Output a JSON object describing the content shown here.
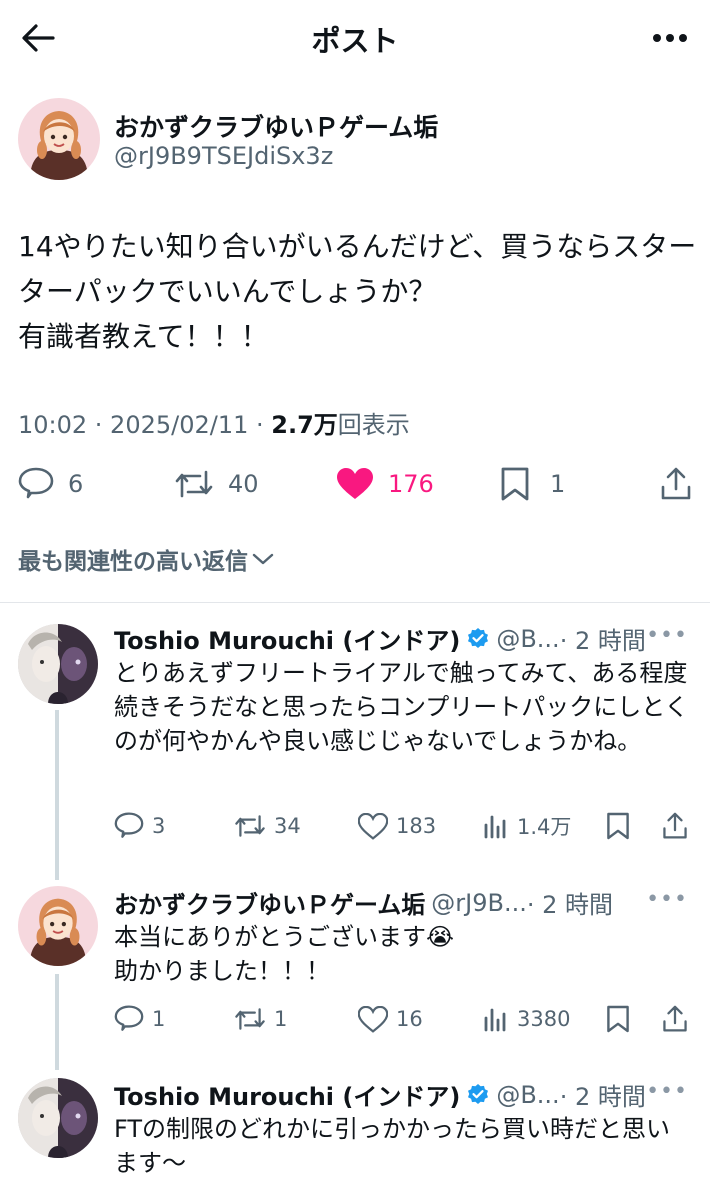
{
  "header": {
    "title": "ポスト"
  },
  "post": {
    "author": "おかずクラブゆいＰゲーム垢",
    "handle": "@rJ9B9TSEJdiSx3z",
    "text": "14やりたい知り合いがいるんだけど、買うならスターターパックでいいんでしょうか？\n有識者教えて！！！",
    "time": "10:02 · 2025/02/11 · ",
    "views": "2.7万",
    "views_label": "回表示",
    "replies": "6",
    "reposts": "40",
    "likes": "176",
    "bookmarks": "1",
    "like_color": "#f91880"
  },
  "sort_label": "最も関連性の高い返信",
  "replies": [
    {
      "author": "Toshio Murouchi (インドア)",
      "handle": "@B...",
      "time": "· 2 時間",
      "text": "とりあえずフリートライアルで触ってみて、ある程度続きそうだなと思ったらコンプリートパックにしとくのが何やかんや良い感じじゃないでしょうかね。",
      "replies": "3",
      "reposts": "34",
      "likes": "183",
      "views": "1.4万",
      "verified": true
    },
    {
      "author": "おかずクラブゆいＰゲーム垢",
      "handle": "@rJ9B...",
      "time": "· 2 時間",
      "text": "本当にありがとうございます😭\n助かりました！！！",
      "replies": "1",
      "reposts": "1",
      "likes": "16",
      "views": "3380",
      "verified": false
    },
    {
      "author": "Toshio Murouchi (インドア)",
      "handle": "@B...",
      "time": "· 2 時間",
      "text": "FTの制限のどれかに引っかかったら買い時だと思います〜",
      "verified": true
    }
  ],
  "icons": {
    "back": "arrow-left-icon",
    "more": "more-horizontal-icon",
    "reply": "reply-bubble-icon",
    "repost": "repost-icon",
    "like": "heart-icon",
    "bookmark": "bookmark-icon",
    "share": "share-icon",
    "views": "bar-chart-icon",
    "verified": "verified-badge-icon",
    "chevron": "chevron-down-icon"
  },
  "colors": {
    "verified": "#1d9bf0",
    "thread_line": "#cfd9de"
  }
}
